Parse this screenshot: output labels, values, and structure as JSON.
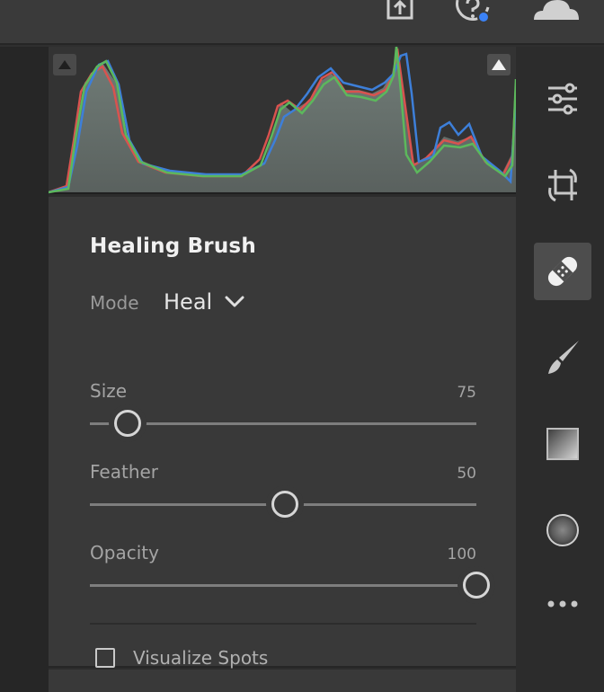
{
  "topbar": {
    "icons": [
      "share-icon",
      "help-icon",
      "cloud-icon"
    ],
    "help_notification_color": "#3b82f6"
  },
  "histogram": {
    "shadow_clip_icon": "triangle-up-icon",
    "highlight_clip_icon": "triangle-up-icon",
    "colors": {
      "red": "#d9534f",
      "green": "#5cb85c",
      "blue": "#3d7fd9"
    }
  },
  "healing": {
    "title": "Healing Brush",
    "mode_label": "Mode",
    "mode_value": "Heal",
    "sliders": [
      {
        "label": "Size",
        "value": "75",
        "fraction": 0.098
      },
      {
        "label": "Feather",
        "value": "50",
        "fraction": 0.505
      },
      {
        "label": "Opacity",
        "value": "100",
        "fraction": 1.0
      }
    ],
    "visualize_label": "Visualize Spots",
    "visualize_checked": false
  },
  "toolbar": {
    "tools": [
      {
        "name": "edit-sliders-icon",
        "active": false
      },
      {
        "name": "crop-rotate-icon",
        "active": false
      },
      {
        "name": "healing-bandage-icon",
        "active": true
      },
      {
        "name": "brush-icon",
        "active": false
      },
      {
        "name": "linear-gradient-icon",
        "active": false
      },
      {
        "name": "radial-gradient-icon",
        "active": false
      },
      {
        "name": "more-icon",
        "active": false
      }
    ]
  }
}
